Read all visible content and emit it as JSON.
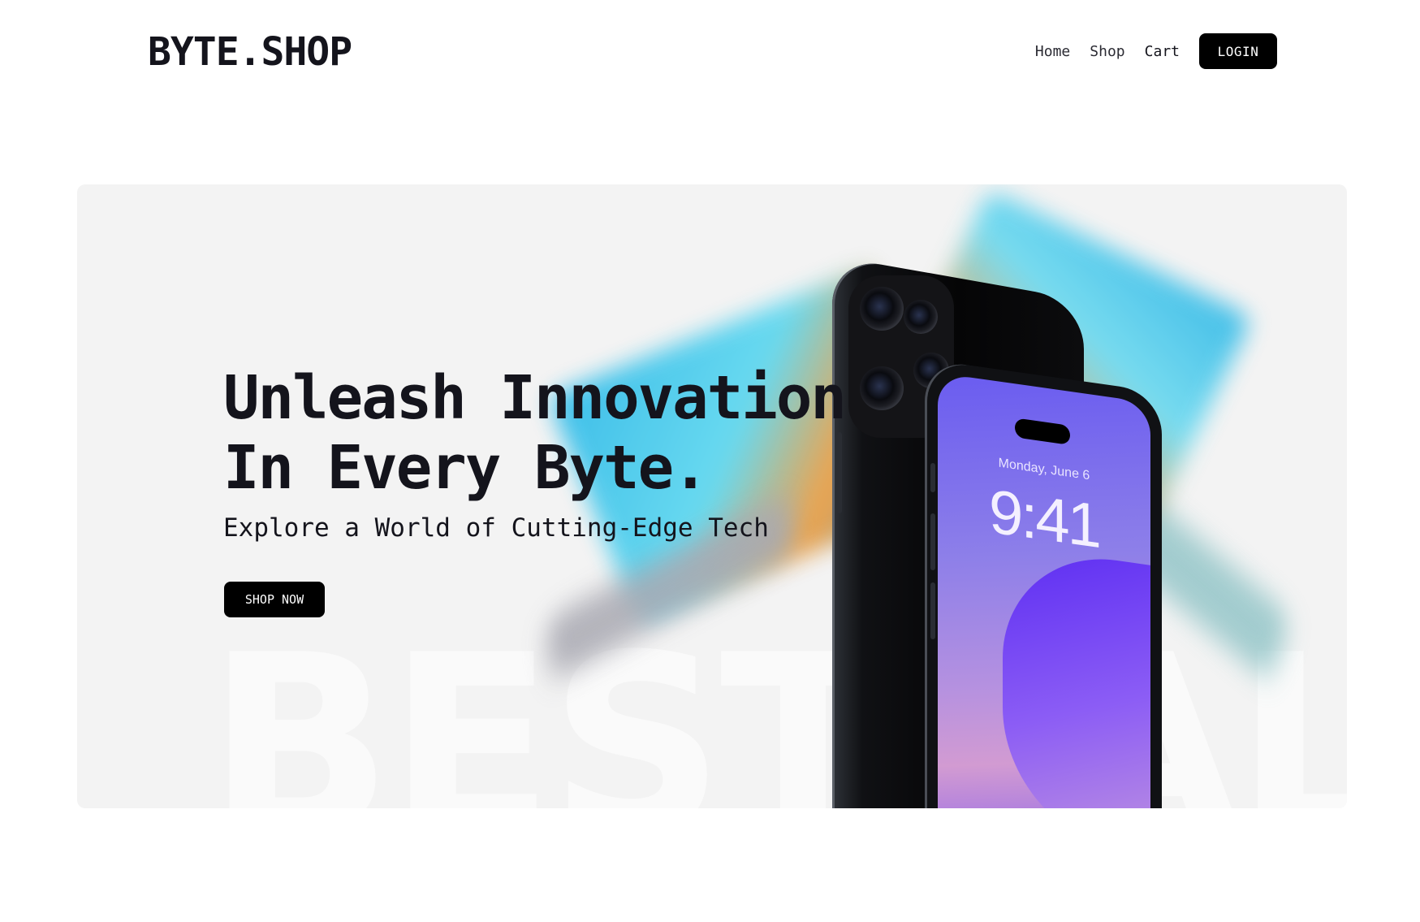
{
  "header": {
    "logo": "BYTE.SHOP",
    "nav": [
      {
        "label": "Home"
      },
      {
        "label": "Shop"
      },
      {
        "label": "Cart"
      }
    ],
    "login_label": "LOGIN"
  },
  "hero": {
    "title_line1": "Unleash Innovation",
    "title_line2": "In Every Byte.",
    "subtitle": "Explore a World of Cutting-Edge Tech",
    "cta_label": "SHOP NOW",
    "watermark": "BESTSALE",
    "phone": {
      "date": "Monday, June 6",
      "time": "9:41"
    }
  },
  "colors": {
    "accent": "#000000",
    "hero_bg": "#f3f3f3",
    "text": "#14141c"
  }
}
